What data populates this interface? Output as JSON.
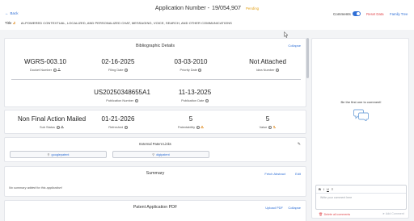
{
  "header": {
    "back_label": "Back",
    "app_title": "Application Number -",
    "app_number": "19/054,907",
    "status": "Pending",
    "comments_label": "Comments",
    "comments_enabled": true,
    "reset_label": "Reset Data",
    "family_label": "Family Tree",
    "title_label": "Title",
    "title_value": "AI-POWERED CONTEXTUAL, LOCALIZED, AND PERSONALIZED CHAT, MESSAGING, VOICE, SEARCH, AND OTHER COMMUNICATIONS"
  },
  "biblio": {
    "heading": "Bibliographic Details",
    "collapse_label": "Collapse",
    "row1": [
      {
        "value": "WGRS-003.10",
        "label": "Docket Number",
        "icons": [
          "info-icon",
          "person-icon"
        ]
      },
      {
        "value": "02-16-2025",
        "label": "Filing Date",
        "icons": [
          "info-icon"
        ]
      },
      {
        "value": "03-03-2010",
        "label": "Priority Date",
        "icons": [
          "info-icon"
        ]
      },
      {
        "value": "Not Attached",
        "label": "Idea Number",
        "icons": [
          "info-icon"
        ]
      }
    ],
    "row2": [
      {
        "value": "US20250348655A1",
        "label": "Publication Number",
        "icons": [
          "info-icon"
        ]
      },
      {
        "value": "11-13-2025",
        "label": "Publication Date",
        "icons": [
          "info-icon"
        ]
      }
    ]
  },
  "status_card": {
    "cells": [
      {
        "value": "Non Final Action Mailed",
        "label": "Sub Status",
        "icons": [
          "info-icon",
          "person-icon"
        ]
      },
      {
        "value": "01-21-2026",
        "label": "Refreshed",
        "icons": [
          "info-icon"
        ]
      },
      {
        "value": "5",
        "label": "Patentability",
        "icons": [
          "info-icon",
          "person-orange-icon"
        ]
      },
      {
        "value": "5",
        "label": "Value",
        "icons": [
          "info-icon",
          "person-orange-icon"
        ]
      }
    ]
  },
  "external": {
    "heading": "External Patent Links",
    "links": [
      "googlepatent",
      "digipatent"
    ]
  },
  "summary": {
    "heading": "Summary",
    "fetch_label": "Fetch Abstract",
    "edit_label": "Edit",
    "empty_text": "No summary added for this application!"
  },
  "pdf": {
    "heading": "Patent Application PDF",
    "upload_label": "Upload PDF",
    "collapse_label": "Collapse"
  },
  "comments_panel": {
    "empty_text": "Be the first one to comment!",
    "toolbar": [
      "B",
      "I",
      "U",
      "≡"
    ],
    "placeholder": "Write your comment here",
    "delete_label": "Delete all comments",
    "add_label": "Add Comment"
  }
}
